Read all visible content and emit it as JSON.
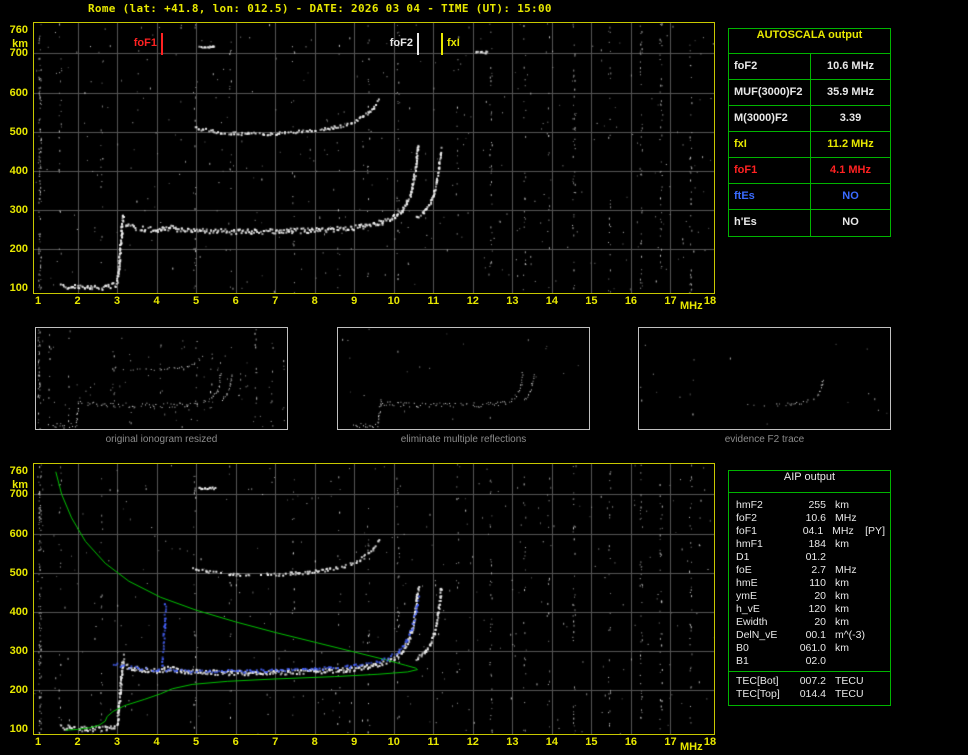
{
  "header": {
    "title": "Rome (lat: +41.8, lon: 012.5) - DATE: 2026 03 04 - TIME (UT): 15:00"
  },
  "colors": {
    "accent_yellow": "#e8e800",
    "plot_border_yellow": "#c8c800",
    "table_border_green": "#00b400",
    "status_red": "#ff2222",
    "status_blue": "#3a6bff",
    "text_white": "#e8e8e8",
    "grid": "#555555",
    "caption_gray": "#8c8c8c",
    "profile_green": "#00c000",
    "restored_trace_blue": "#4663ff",
    "echo_white": "#efefef"
  },
  "autoscala": {
    "title": "AUTOSCALA output",
    "rows": [
      {
        "label": "foF2",
        "value": "10.6 MHz",
        "color": "#e8e8e8"
      },
      {
        "label": "MUF(3000)F2",
        "value": "35.9 MHz",
        "color": "#e8e8e8"
      },
      {
        "label": "M(3000)F2",
        "value": "3.39",
        "color": "#e8e8e8"
      },
      {
        "label": "fxI",
        "value": "11.2 MHz",
        "color": "#e8e800"
      },
      {
        "label": "foF1",
        "value": "4.1 MHz",
        "color": "#ff2222"
      },
      {
        "label": "ftEs",
        "value": "NO",
        "color": "#3a6bff"
      },
      {
        "label": "h'Es",
        "value": "NO",
        "color": "#e8e8e8"
      }
    ]
  },
  "thumbnails": [
    {
      "caption": "original ionogram resized"
    },
    {
      "caption": "eliminate multiple reflections"
    },
    {
      "caption": "evidence F2 trace"
    }
  ],
  "aip": {
    "title": "AIP output",
    "rows": [
      {
        "name": "hmF2",
        "value": "255",
        "unit": "km",
        "note": ""
      },
      {
        "name": "foF2",
        "value": "10.6",
        "unit": "MHz",
        "note": ""
      },
      {
        "name": "foF1",
        "value": "04.1",
        "unit": "MHz",
        "note": "[PY]"
      },
      {
        "name": "hmF1",
        "value": "184",
        "unit": "km",
        "note": ""
      },
      {
        "name": "D1",
        "value": "01.2",
        "unit": "",
        "note": ""
      },
      {
        "name": "foE",
        "value": "2.7",
        "unit": "MHz",
        "note": ""
      },
      {
        "name": "hmE",
        "value": "110",
        "unit": "km",
        "note": ""
      },
      {
        "name": "ymE",
        "value": "20",
        "unit": "km",
        "note": ""
      },
      {
        "name": "h_vE",
        "value": "120",
        "unit": "km",
        "note": ""
      },
      {
        "name": "Ewidth",
        "value": "20",
        "unit": "km",
        "note": ""
      },
      {
        "name": "DelN_vE",
        "value": "00.1",
        "unit": "m^(-3)",
        "note": ""
      },
      {
        "name": "B0",
        "value": "061.0",
        "unit": "km",
        "note": ""
      },
      {
        "name": "B1",
        "value": "02.0",
        "unit": "",
        "note": ""
      }
    ],
    "tec_rows": [
      {
        "name": "TEC[Bot]",
        "value": "007.2",
        "unit": "TECU"
      },
      {
        "name": "TEC[Top]",
        "value": "014.4",
        "unit": "TECU"
      }
    ]
  },
  "chart_data": {
    "type": "scatter",
    "title": "Ionogram with AUTOSCALA interpretation",
    "xlabel": "MHz",
    "ylabel": "km",
    "xlim": [
      1,
      18
    ],
    "ylim": [
      100,
      760
    ],
    "x_ticks": [
      1,
      2,
      3,
      4,
      5,
      6,
      7,
      8,
      9,
      10,
      11,
      12,
      13,
      14,
      15,
      16,
      17,
      18
    ],
    "y_ticks": [
      760,
      700,
      600,
      500,
      400,
      300,
      200,
      100
    ],
    "grid": true,
    "scaled_values": {
      "foF2_MHz": 10.6,
      "fxI_MHz": 11.2,
      "foF1_MHz": 4.1,
      "MUF3000F2_MHz": 35.9,
      "M3000F2": 3.39,
      "hmF2_km": 255,
      "hmF1_km": 184,
      "foE_MHz": 2.7,
      "hmE_km": 110
    },
    "markers": [
      {
        "label": "foF1",
        "freq": 4.1,
        "color": "#ff2222",
        "label_side": "left"
      },
      {
        "label": "foF2",
        "freq": 10.6,
        "color": "#e8e8e8",
        "label_side": "left"
      },
      {
        "label": "fxI",
        "freq": 11.2,
        "color": "#e8e800",
        "label_side": "right"
      }
    ],
    "rfi_lines": [
      [
        1.04,
        0.5
      ],
      [
        1.55,
        0.1
      ],
      [
        2.6,
        0.08
      ],
      [
        4.95,
        0.1
      ],
      [
        5.85,
        0.08
      ],
      [
        7.45,
        0.09
      ],
      [
        8.6,
        0.06
      ],
      [
        9.35,
        0.1
      ],
      [
        10.1,
        0.12
      ],
      [
        11.6,
        0.06
      ],
      [
        12.45,
        0.16
      ],
      [
        13.3,
        0.1
      ],
      [
        13.9,
        0.08
      ],
      [
        14.55,
        0.18
      ],
      [
        15.45,
        0.12
      ],
      [
        16.25,
        0.2
      ],
      [
        16.75,
        0.18
      ],
      [
        17.5,
        0.16
      ]
    ],
    "series": [
      {
        "name": "E-layer",
        "color": "#efefef",
        "style": "scatter",
        "thickness": 5,
        "density": 0.85,
        "points": [
          [
            1.55,
            108
          ],
          [
            1.9,
            104
          ],
          [
            2.3,
            102
          ],
          [
            2.7,
            104
          ],
          [
            2.95,
            110
          ]
        ]
      },
      {
        "name": "E-cusp",
        "color": "#efefef",
        "style": "scatter",
        "thickness": 4,
        "density": 0.9,
        "points": [
          [
            2.98,
            112
          ],
          [
            3.02,
            150
          ],
          [
            3.06,
            200
          ],
          [
            3.1,
            250
          ],
          [
            3.14,
            288
          ]
        ]
      },
      {
        "name": "F-trace",
        "color": "#efefef",
        "style": "scatter",
        "thickness": 5,
        "density": 0.85,
        "points": [
          [
            3.2,
            262
          ],
          [
            3.6,
            254
          ],
          [
            4.05,
            250
          ],
          [
            4.15,
            254
          ],
          [
            4.3,
            257
          ],
          [
            4.6,
            251
          ],
          [
            5.0,
            248
          ],
          [
            6.0,
            246
          ],
          [
            7.0,
            247
          ],
          [
            8.0,
            250
          ],
          [
            8.8,
            254
          ],
          [
            9.3,
            261
          ],
          [
            9.7,
            271
          ],
          [
            10.0,
            284
          ],
          [
            10.2,
            302
          ],
          [
            10.35,
            327
          ],
          [
            10.45,
            357
          ],
          [
            10.52,
            397
          ],
          [
            10.57,
            440
          ],
          [
            10.6,
            468
          ]
        ]
      },
      {
        "name": "F-trace-X",
        "color": "#efefef",
        "style": "scatter",
        "thickness": 3,
        "density": 0.75,
        "points": [
          [
            10.55,
            282
          ],
          [
            10.75,
            297
          ],
          [
            10.9,
            318
          ],
          [
            11.0,
            345
          ],
          [
            11.08,
            380
          ],
          [
            11.14,
            422
          ],
          [
            11.18,
            462
          ]
        ]
      },
      {
        "name": "second-hop",
        "color": "#efefef",
        "style": "scatter",
        "thickness": 3,
        "density": 0.5,
        "points": [
          [
            4.9,
            512
          ],
          [
            5.5,
            501
          ],
          [
            6.2,
            496
          ],
          [
            7.0,
            497
          ],
          [
            7.8,
            503
          ],
          [
            8.4,
            511
          ],
          [
            8.9,
            523
          ],
          [
            9.2,
            540
          ],
          [
            9.45,
            562
          ],
          [
            9.6,
            588
          ]
        ]
      },
      {
        "name": "dash-a",
        "color": "#efefef",
        "style": "scatter",
        "thickness": 2,
        "density": 0.95,
        "points": [
          [
            5.05,
            718
          ],
          [
            5.45,
            718
          ]
        ]
      },
      {
        "name": "dash-b",
        "color": "#efefef",
        "style": "scatter",
        "thickness": 2,
        "density": 0.95,
        "points": [
          [
            12.05,
            705
          ],
          [
            12.35,
            705
          ]
        ]
      },
      {
        "name": "profile",
        "color": "#00c000",
        "style": "line",
        "thickness": 1,
        "density": 1,
        "points": [
          [
            1.45,
            758
          ],
          [
            1.6,
            700
          ],
          [
            1.85,
            640
          ],
          [
            2.2,
            580
          ],
          [
            2.7,
            524
          ],
          [
            3.3,
            478
          ],
          [
            4.1,
            437
          ],
          [
            5.0,
            404
          ],
          [
            6.0,
            374
          ],
          [
            7.0,
            347
          ],
          [
            8.0,
            322
          ],
          [
            9.0,
            297
          ],
          [
            9.8,
            277
          ],
          [
            10.3,
            263
          ],
          [
            10.55,
            256
          ],
          [
            10.6,
            252
          ],
          [
            10.35,
            246
          ],
          [
            9.6,
            240
          ],
          [
            8.5,
            234
          ],
          [
            7.0,
            228
          ],
          [
            5.8,
            222
          ],
          [
            4.9,
            214
          ],
          [
            4.4,
            203
          ],
          [
            4.1,
            190
          ],
          [
            3.7,
            176
          ],
          [
            3.2,
            160
          ],
          [
            2.9,
            145
          ],
          [
            2.75,
            132
          ],
          [
            2.7,
            120
          ],
          [
            2.55,
            110
          ],
          [
            2.3,
            103
          ],
          [
            2.0,
            99
          ],
          [
            1.7,
            97
          ]
        ]
      },
      {
        "name": "restored-trace",
        "color": "#4663ff",
        "style": "dots",
        "thickness": 3,
        "density": 0.75,
        "points": [
          [
            2.85,
            272
          ],
          [
            3.1,
            263
          ],
          [
            3.5,
            257
          ],
          [
            4.0,
            252
          ],
          [
            4.5,
            252
          ],
          [
            5.0,
            250
          ],
          [
            6.0,
            250
          ],
          [
            7.0,
            252
          ],
          [
            8.0,
            256
          ],
          [
            8.8,
            261
          ],
          [
            9.3,
            268
          ],
          [
            9.8,
            281
          ],
          [
            10.1,
            299
          ],
          [
            10.3,
            327
          ],
          [
            10.45,
            363
          ],
          [
            10.55,
            406
          ],
          [
            10.6,
            438
          ]
        ]
      },
      {
        "name": "F1-spike",
        "color": "#4663ff",
        "style": "dots",
        "thickness": 3,
        "density": 0.8,
        "points": [
          [
            4.12,
            262
          ],
          [
            4.15,
            310
          ],
          [
            4.18,
            365
          ],
          [
            4.2,
            420
          ]
        ]
      },
      {
        "name": "F2-evidence",
        "color": "#efefef",
        "style": "scatter",
        "thickness": 3,
        "density": 0.5,
        "points": [
          [
            6.5,
            247
          ],
          [
            7.3,
            248
          ],
          [
            8.2,
            251
          ],
          [
            8.9,
            255
          ],
          [
            9.4,
            263
          ],
          [
            9.8,
            276
          ],
          [
            10.1,
            294
          ],
          [
            10.3,
            320
          ],
          [
            10.42,
            352
          ],
          [
            10.5,
            390
          ],
          [
            10.55,
            430
          ]
        ]
      }
    ],
    "plots": {
      "main": {
        "seed": 7,
        "grid": true,
        "rfi": true,
        "speckle": 340,
        "series": [
          "E-layer",
          "E-cusp",
          "F-trace",
          "F-trace-X",
          "second-hop",
          "dash-a",
          "dash-b"
        ]
      },
      "processed": {
        "seed": 11,
        "grid": true,
        "rfi": true,
        "speckle": 300,
        "series": [
          "E-layer",
          "E-cusp",
          "F-trace",
          "F-trace-X",
          "second-hop",
          "dash-a",
          "profile",
          "restored-trace",
          "F1-spike"
        ]
      },
      "thumb1": {
        "seed": 21,
        "grid": false,
        "rfi": true,
        "speckle": 50,
        "xlim": [
          1,
          14
        ],
        "series": [
          "E-layer",
          "E-cusp",
          "F-trace",
          "F-trace-X",
          "second-hop"
        ]
      },
      "thumb2": {
        "seed": 22,
        "grid": false,
        "rfi": false,
        "speckle": 22,
        "xlim": [
          1,
          14
        ],
        "series": [
          "E-layer",
          "E-cusp",
          "F-trace",
          "F-trace-X"
        ]
      },
      "thumb3": {
        "seed": 23,
        "grid": false,
        "rfi": false,
        "speckle": 20,
        "xlim": [
          1,
          14
        ],
        "series": [
          "F2-evidence"
        ]
      }
    }
  }
}
